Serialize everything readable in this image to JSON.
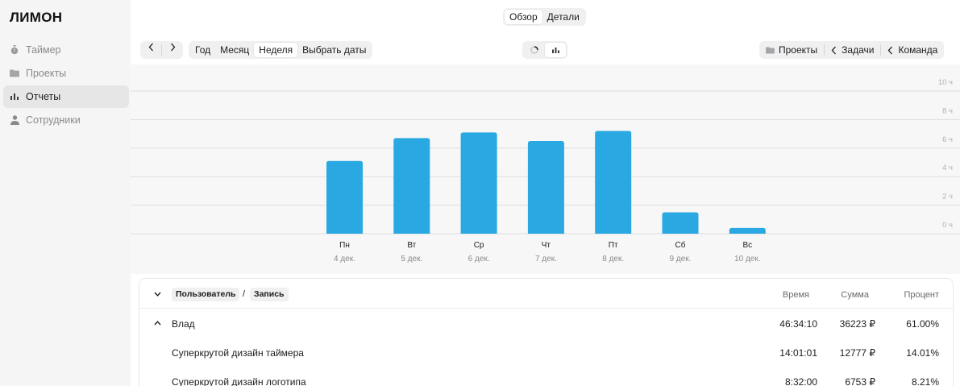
{
  "app": {
    "logo": "ЛИМОН"
  },
  "sidebar": {
    "items": [
      {
        "label": "Таймер",
        "icon": "timer-icon",
        "active": false
      },
      {
        "label": "Проекты",
        "icon": "folder-icon",
        "active": false
      },
      {
        "label": "Отчеты",
        "icon": "bar-chart-icon",
        "active": true
      },
      {
        "label": "Сотрудники",
        "icon": "person-icon",
        "active": false
      }
    ]
  },
  "view_tabs": [
    {
      "label": "Обзор",
      "active": true
    },
    {
      "label": "Детали",
      "active": false
    }
  ],
  "period_tabs": [
    {
      "label": "Год",
      "active": false
    },
    {
      "label": "Месяц",
      "active": false
    },
    {
      "label": "Неделя",
      "active": true
    },
    {
      "label": "Выбрать даты",
      "active": false
    }
  ],
  "group_tabs": [
    {
      "label": "Проекты",
      "icon": "folder-icon"
    },
    {
      "label": "Задачи",
      "icon": "chevron-left-icon"
    },
    {
      "label": "Команда",
      "icon": "chevron-left-icon"
    }
  ],
  "chart_data": {
    "type": "bar",
    "categories": [
      "Пн",
      "Вт",
      "Ср",
      "Чт",
      "Пт",
      "Сб",
      "Вс"
    ],
    "dates": [
      "4 дек.",
      "5 дек.",
      "6 дек.",
      "7 дек.",
      "8 дек.",
      "9 дек.",
      "10 дек."
    ],
    "values": [
      5.1,
      6.7,
      7.1,
      6.5,
      7.2,
      1.5,
      0.4
    ],
    "y_ticks": [
      "10 ч",
      "8 ч",
      "6 ч",
      "4 ч",
      "2 ч",
      "0 ч"
    ],
    "ylim": [
      0,
      10
    ],
    "bar_color": "#29a8e1",
    "grid": true
  },
  "table": {
    "group_user": "Пользователь",
    "group_sep": "/",
    "group_entry": "Запись",
    "columns": [
      "Время",
      "Сумма",
      "Процент"
    ],
    "user_row": {
      "name": "Влад",
      "time": "46:34:10",
      "sum": "36223 ₽",
      "percent": "61.00%"
    },
    "rows": [
      {
        "name": "Суперкрутой дизайн таймера",
        "time": "14:01:01",
        "sum": "12777 ₽",
        "percent": "14.01%"
      },
      {
        "name": "Суперкрутой дизайн логотипа",
        "time": "8:32:00",
        "sum": "6753 ₽",
        "percent": "8.21%"
      }
    ]
  }
}
